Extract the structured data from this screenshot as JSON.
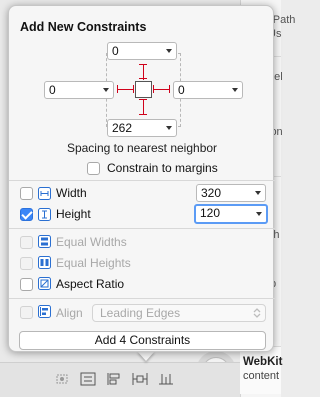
{
  "popover": {
    "title": "Add New Constraints",
    "spacing": {
      "top": "0",
      "left": "0",
      "right": "0",
      "bottom": "262",
      "caption": "Spacing to nearest neighbor",
      "constrain_to_margins": "Constrain to margins",
      "constrain_to_margins_checked": false
    },
    "size": {
      "width_label": "Width",
      "width_value": "320",
      "width_checked": false,
      "height_label": "Height",
      "height_value": "120",
      "height_checked": true
    },
    "options": {
      "equal_widths": "Equal Widths",
      "equal_heights": "Equal Heights",
      "aspect_ratio": "Aspect Ratio"
    },
    "align": {
      "label": "Align",
      "value": "Leading Edges"
    },
    "add_button": "Add 4 Constraints"
  },
  "inspector": {
    "snippets": [
      "Full Path",
      "Us",
      "nel",
      "ion",
      "Sh",
      "p"
    ],
    "library_title": "WebKit",
    "library_subtitle": "content"
  },
  "toolbar": {
    "icons": [
      "embed-in-stack-icon",
      "align-icon",
      "pin-icon",
      "resolve-issues-icon",
      "update-frames-icon"
    ]
  },
  "colors": {
    "accent": "#3b86f7",
    "strut_red": "#d0021b",
    "focus_ring": "#5b9bf5"
  }
}
